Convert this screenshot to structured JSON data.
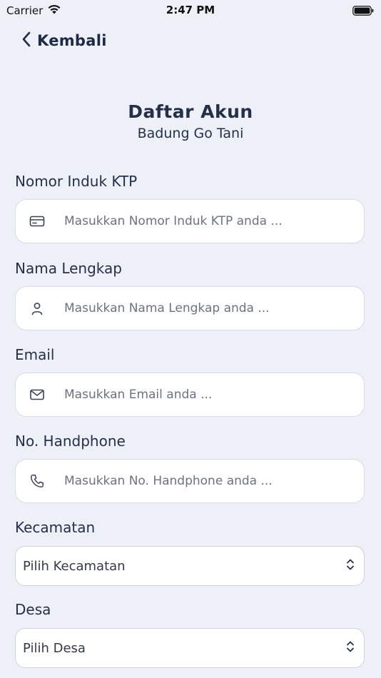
{
  "status_bar": {
    "carrier": "Carrier",
    "time": "2:47 PM"
  },
  "nav": {
    "back_label": "Kembali"
  },
  "header": {
    "title": "Daftar Akun",
    "subtitle": "Badung Go Tani"
  },
  "form": {
    "ktp": {
      "label": "Nomor Induk KTP",
      "placeholder": "Masukkan Nomor Induk KTP anda ...",
      "icon": "id-card-icon"
    },
    "name": {
      "label": "Nama Lengkap",
      "placeholder": "Masukkan Nama Lengkap anda ...",
      "icon": "user-icon"
    },
    "email": {
      "label": "Email",
      "placeholder": "Masukkan Email anda ...",
      "icon": "mail-icon"
    },
    "phone": {
      "label": "No. Handphone",
      "placeholder": "Masukkan No. Handphone anda ...",
      "icon": "phone-icon"
    },
    "kecamatan": {
      "label": "Kecamatan",
      "selected": "Pilih Kecamatan"
    },
    "desa": {
      "label": "Desa",
      "selected": "Pilih Desa"
    }
  },
  "colors": {
    "background": "#eef0f8",
    "text": "#253048",
    "field_bg": "#ffffff",
    "border": "#d9dce6",
    "placeholder": "#6b7280"
  }
}
